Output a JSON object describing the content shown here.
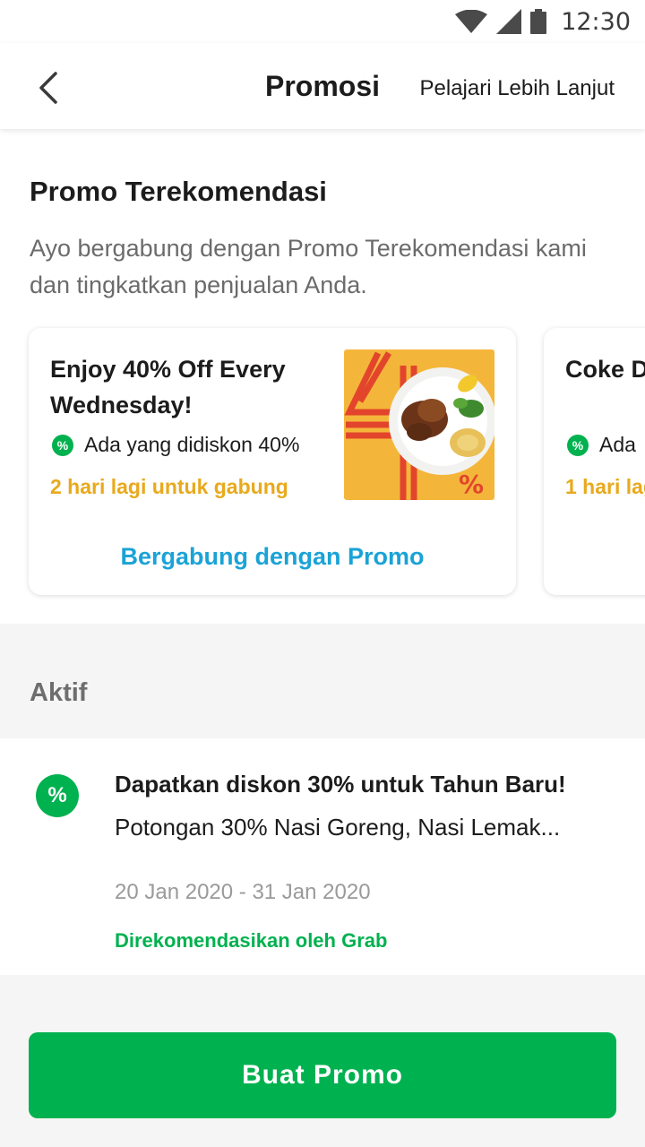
{
  "status_bar": {
    "time": "12:30",
    "icons": [
      "wifi-icon",
      "cell-signal-icon",
      "battery-icon"
    ]
  },
  "app_bar": {
    "title": "Promosi",
    "back_icon": "chevron-left-icon",
    "learn_more": "Pelajari Lebih Lanjut"
  },
  "recommended": {
    "title": "Promo Terekomendasi",
    "subtitle": "Ayo bergabung dengan Promo Terekomendasi kami dan tingkatkan penjualan Anda.",
    "cards": [
      {
        "title": "Enjoy 40% Off Every Wednesday!",
        "badge": "Ada yang didiskon 40%",
        "deadline": "2 hari lagi untuk gabung",
        "join_label": "Bergabung dengan Promo",
        "image": "food-plate-40-percent"
      },
      {
        "title": "Coke D",
        "badge": "Ada",
        "deadline": "1 hari lag"
      }
    ]
  },
  "active": {
    "label": "Aktif",
    "items": [
      {
        "title": "Dapatkan diskon 30% untuk Tahun Baru!",
        "description": "Potongan 30% Nasi Goreng, Nasi Lemak...",
        "dates": "20 Jan 2020 - 31 Jan 2020",
        "recommended_by": "Direkomendasikan oleh Grab"
      }
    ]
  },
  "create_button": "Buat Promo",
  "colors": {
    "brand_green": "#00b14f",
    "link_blue": "#1aa3d6",
    "deadline_orange": "#e8a91c"
  }
}
